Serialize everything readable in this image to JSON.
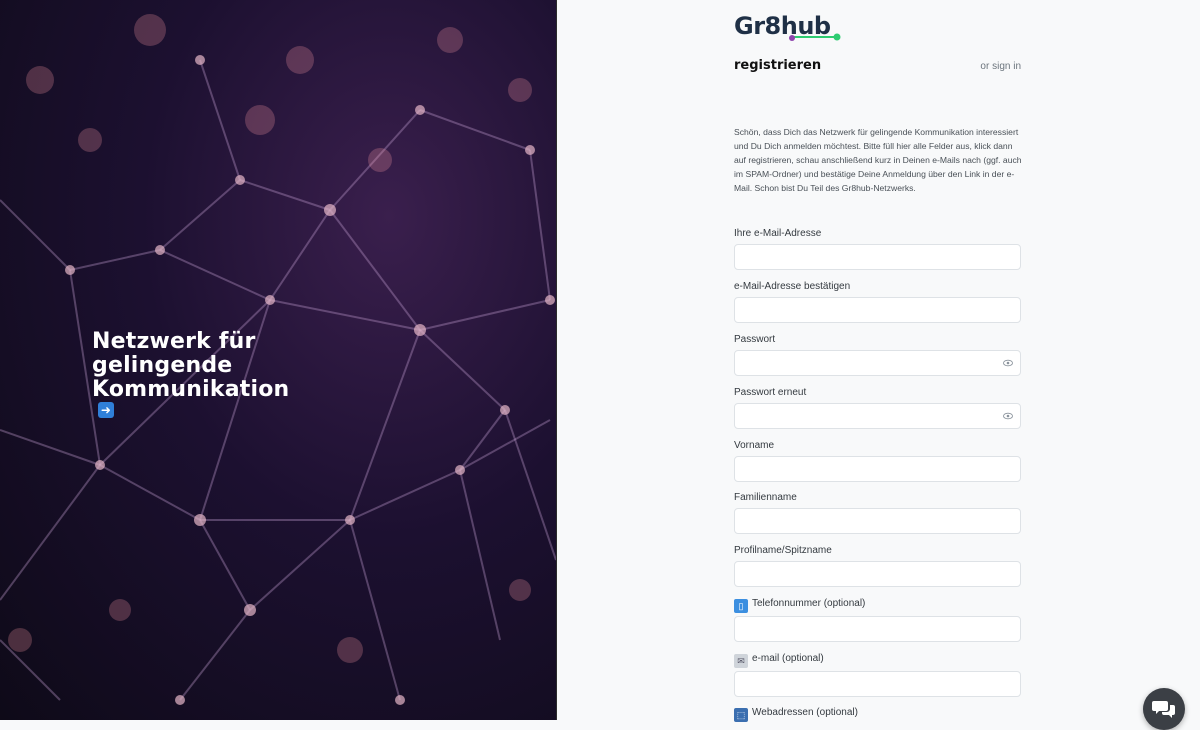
{
  "hero": {
    "title_line1": "Netzwerk für",
    "title_line2": "gelingende",
    "title_line3": "Kommunikation",
    "arrow_icon": "right-arrow-icon"
  },
  "brand": {
    "logo_text": "Gr8hub",
    "accent_colors": [
      "#8e44ad",
      "#2ecc71"
    ]
  },
  "form": {
    "heading": "registrieren",
    "signin_prefix": "or",
    "signin_link": "sign in",
    "intro": "Schön, dass Dich das Netzwerk für gelingende Kommunikation interessiert und Du Dich anmelden möchtest. Bitte füll hier alle Felder aus, klick dann auf registrieren, schau anschließend kurz in Deinen e-Mails nach (ggf. auch im SPAM-Ordner) und bestätige Deine Anmeldung über den Link in der e-Mail. Schon bist Du Teil des Gr8hub-Netzwerks.",
    "fields": {
      "email": {
        "label": "Ihre e-Mail-Adresse",
        "value": ""
      },
      "email_confirm": {
        "label": "e-Mail-Adresse bestätigen",
        "value": ""
      },
      "password": {
        "label": "Passwort",
        "value": ""
      },
      "password_repeat": {
        "label": "Passwort erneut",
        "value": ""
      },
      "first_name": {
        "label": "Vorname",
        "value": ""
      },
      "last_name": {
        "label": "Familienname",
        "value": ""
      },
      "nickname": {
        "label": "Profilname/Spitzname",
        "value": ""
      },
      "phone": {
        "label": "Telefonnummer (optional)",
        "icon": "mobile-phone-icon",
        "value": ""
      },
      "email_optional": {
        "label": "e-mail (optional)",
        "icon": "envelope-icon",
        "value": ""
      },
      "web": {
        "label": "Webadressen (optional)",
        "icon": "web-link-icon"
      }
    }
  },
  "chat": {
    "icon": "chat-bubbles-icon"
  }
}
